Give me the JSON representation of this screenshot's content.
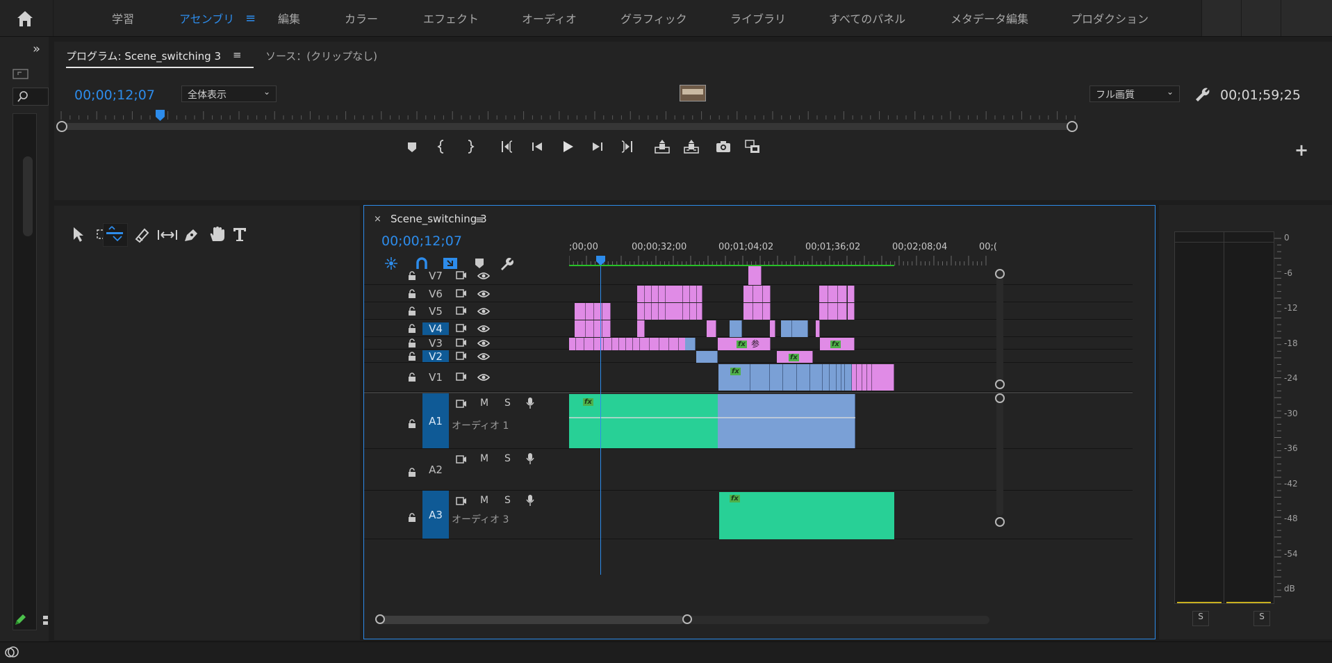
{
  "workspaces": [
    "学習",
    "アセンブリ",
    "編集",
    "カラー",
    "エフェクト",
    "オーディオ",
    "グラフィック",
    "ライブラリ",
    "すべてのパネル",
    "メタデータ編集",
    "プロダクション"
  ],
  "active_workspace_index": 1,
  "program": {
    "tab_label": "プログラム: Scene_switching 3",
    "source_tab_label": "ソース：(クリップなし)",
    "timecode": "00;00;12;07",
    "zoom_value": "全体表示",
    "quality_value": "フル画質",
    "duration": "00;01;59;25",
    "playhead_fraction": 0.097
  },
  "timeline": {
    "sequence_name": "Scene_switching 3",
    "timecode": "00;00;12;07",
    "ruler_labels": [
      ";00;00",
      "00;00;32;00",
      "00;01;04;02",
      "00;01;36;02",
      "00;02;08;04",
      "00;("
    ],
    "video_tracks": [
      {
        "name": "V7",
        "target": false
      },
      {
        "name": "V6",
        "target": false
      },
      {
        "name": "V5",
        "target": false
      },
      {
        "name": "V4",
        "target": true
      },
      {
        "name": "V3",
        "target": false
      },
      {
        "name": "V2",
        "target": true
      },
      {
        "name": "V1",
        "target": false
      }
    ],
    "audio_tracks": [
      {
        "name": "A1",
        "label": "オーディオ 1",
        "target": true
      },
      {
        "name": "A2",
        "label": "",
        "target": false
      },
      {
        "name": "A3",
        "label": "オーディオ 3",
        "target": true
      }
    ],
    "m_label": "M",
    "s_label": "S",
    "clip_char": "参",
    "fx_label": "fx"
  },
  "meter": {
    "scale": [
      "0",
      "-6",
      "-12",
      "-18",
      "-24",
      "-30",
      "-36",
      "-42",
      "-48",
      "-54",
      "dB"
    ],
    "solo_labels": [
      "S",
      "S"
    ]
  },
  "colors": {
    "accent": "#2d8ceb",
    "video_clip": "#e08be6",
    "video_clip_alt": "#7aa0d6",
    "audio_clip": "#28d096"
  }
}
